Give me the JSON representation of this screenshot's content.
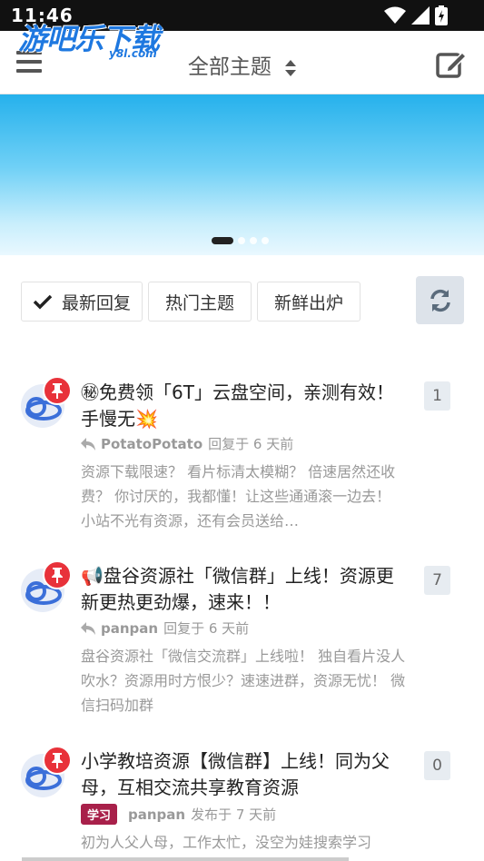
{
  "status_bar": {
    "time": "11:46"
  },
  "watermark": {
    "text": "游吧乐下载",
    "sub": "y8l.com"
  },
  "navbar": {
    "title": "全部主题"
  },
  "banner": {
    "slide_count": 4,
    "active_slide": 1
  },
  "tabs": [
    {
      "label": "最新回复",
      "active": true
    },
    {
      "label": "热门主题",
      "active": false
    },
    {
      "label": "新鲜出炉",
      "active": false
    }
  ],
  "topics": [
    {
      "title": "㊙免费领「6T」云盘空间，亲测有效！手慢无💥",
      "user": "PotatoPotato",
      "action": "回复于 6 天前",
      "excerpt": "资源下载限速？ 看片标清太模糊？ 倍速居然还收费？ 你讨厌的，我都懂！让这些通通滚一边去！ 小站不光有资源，还有会员送给…",
      "count": "1",
      "tag": ""
    },
    {
      "title": "📢盘谷资源社「微信群」上线！资源更新更热更劲爆，速来！！",
      "user": "panpan",
      "action": "回复于 6 天前",
      "excerpt": "盘谷资源社「微信交流群」上线啦！ 独自看片没人吹水？资源用时方恨少？速速进群，资源无忧！ 微信扫码加群",
      "count": "7",
      "tag": ""
    },
    {
      "title": "小学教培资源【微信群】上线！同为父母，互相交流共享教育资源",
      "user": "panpan",
      "action": "发布于 7 天前",
      "excerpt": "初为人父人母，工作太忙，没空为娃搜索学习",
      "count": "0",
      "tag": "学习"
    }
  ],
  "colors": {
    "accent": "#1e78e0",
    "pin": "#e8323a",
    "tag": "#a8204a",
    "banner_top": "#26b1ec"
  }
}
